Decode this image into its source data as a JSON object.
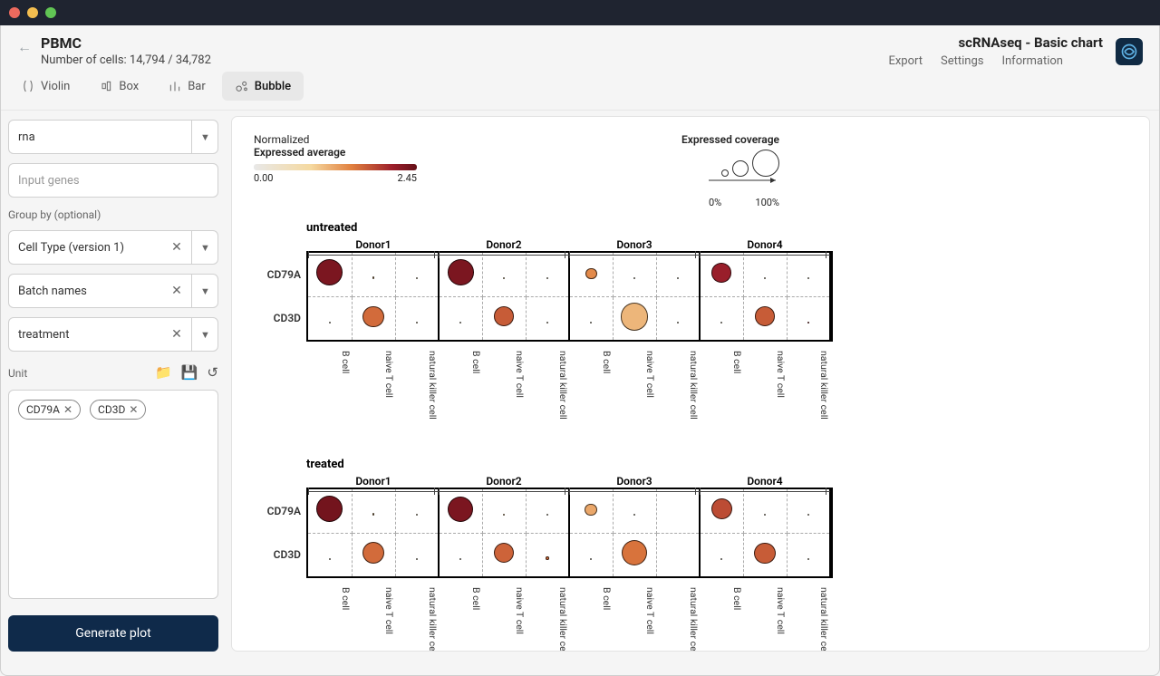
{
  "header": {
    "title": "PBMC",
    "subtitle": "Number of cells: 14,794 / 34,782",
    "brand": "scRNAseq - Basic chart",
    "nav": {
      "export": "Export",
      "settings": "Settings",
      "information": "Information"
    }
  },
  "tabs": {
    "violin": "Violin",
    "box": "Box",
    "bar": "Bar",
    "bubble": "Bubble"
  },
  "sidebar": {
    "assay_value": "rna",
    "gene_placeholder": "Input genes",
    "groupby_label": "Group by (optional)",
    "group1": "Cell Type (version 1)",
    "group2": "Batch names",
    "group3": "treatment",
    "unit_label": "Unit",
    "chips": {
      "c1": "CD79A",
      "c2": "CD3D"
    },
    "generate": "Generate plot"
  },
  "legends": {
    "normalized": "Normalized",
    "expr_avg": "Expressed average",
    "min": "0.00",
    "max": "2.45",
    "coverage": "Expressed coverage",
    "cov_min": "0%",
    "cov_max": "100%"
  },
  "panels": {
    "p1": "untreated",
    "p2": "treated"
  },
  "donors": {
    "d1": "Donor1",
    "d2": "Donor2",
    "d3": "Donor3",
    "d4": "Donor4"
  },
  "genes": {
    "g1": "CD79A",
    "g2": "CD3D"
  },
  "celltypes": {
    "c1": "B cell",
    "c2": "naive T cell",
    "c3": "natural killer cell"
  },
  "chart_data": {
    "type": "bubble",
    "size_encodes": "expressed_coverage_percent",
    "color_encodes": "expressed_average",
    "color_scale": [
      0.0,
      2.45
    ],
    "size_scale_percent": [
      0,
      100
    ],
    "cell_types": [
      "B cell",
      "naive T cell",
      "natural killer cell"
    ],
    "donors": [
      "Donor1",
      "Donor2",
      "Donor3",
      "Donor4"
    ],
    "genes": [
      "CD79A",
      "CD3D"
    ],
    "panels": [
      {
        "treatment": "untreated",
        "values": [
          {
            "gene": "CD79A",
            "donor": "Donor1",
            "cell_type": "B cell",
            "avg": 2.3,
            "cov": 80
          },
          {
            "gene": "CD79A",
            "donor": "Donor1",
            "cell_type": "naive T cell",
            "avg": 1.0,
            "cov": 8
          },
          {
            "gene": "CD79A",
            "donor": "Donor1",
            "cell_type": "natural killer cell",
            "avg": 0.5,
            "cov": 3
          },
          {
            "gene": "CD79A",
            "donor": "Donor2",
            "cell_type": "B cell",
            "avg": 2.3,
            "cov": 80
          },
          {
            "gene": "CD79A",
            "donor": "Donor2",
            "cell_type": "naive T cell",
            "avg": 0.8,
            "cov": 5
          },
          {
            "gene": "CD79A",
            "donor": "Donor2",
            "cell_type": "natural killer cell",
            "avg": 0.4,
            "cov": 2
          },
          {
            "gene": "CD79A",
            "donor": "Donor3",
            "cell_type": "B cell",
            "avg": 1.4,
            "cov": 35
          },
          {
            "gene": "CD79A",
            "donor": "Donor3",
            "cell_type": "naive T cell",
            "avg": 0.3,
            "cov": 2
          },
          {
            "gene": "CD79A",
            "donor": "Donor3",
            "cell_type": "natural killer cell",
            "avg": 0.3,
            "cov": 2
          },
          {
            "gene": "CD79A",
            "donor": "Donor4",
            "cell_type": "B cell",
            "avg": 2.1,
            "cov": 60
          },
          {
            "gene": "CD79A",
            "donor": "Donor4",
            "cell_type": "naive T cell",
            "avg": 0.4,
            "cov": 3
          },
          {
            "gene": "CD79A",
            "donor": "Donor4",
            "cell_type": "natural killer cell",
            "avg": 0.4,
            "cov": 3
          },
          {
            "gene": "CD3D",
            "donor": "Donor1",
            "cell_type": "B cell",
            "avg": 0.3,
            "cov": 2
          },
          {
            "gene": "CD3D",
            "donor": "Donor1",
            "cell_type": "naive T cell",
            "avg": 1.6,
            "cov": 65
          },
          {
            "gene": "CD3D",
            "donor": "Donor1",
            "cell_type": "natural killer cell",
            "avg": 0.5,
            "cov": 4
          },
          {
            "gene": "CD3D",
            "donor": "Donor2",
            "cell_type": "B cell",
            "avg": 0.3,
            "cov": 2
          },
          {
            "gene": "CD3D",
            "donor": "Donor2",
            "cell_type": "naive T cell",
            "avg": 1.7,
            "cov": 60
          },
          {
            "gene": "CD3D",
            "donor": "Donor2",
            "cell_type": "natural killer cell",
            "avg": 0.4,
            "cov": 3
          },
          {
            "gene": "CD3D",
            "donor": "Donor3",
            "cell_type": "B cell",
            "avg": 0.3,
            "cov": 2
          },
          {
            "gene": "CD3D",
            "donor": "Donor3",
            "cell_type": "naive T cell",
            "avg": 1.1,
            "cov": 85
          },
          {
            "gene": "CD3D",
            "donor": "Donor3",
            "cell_type": "natural killer cell",
            "avg": 0.3,
            "cov": 2
          },
          {
            "gene": "CD3D",
            "donor": "Donor4",
            "cell_type": "B cell",
            "avg": 0.3,
            "cov": 2
          },
          {
            "gene": "CD3D",
            "donor": "Donor4",
            "cell_type": "naive T cell",
            "avg": 1.7,
            "cov": 60
          },
          {
            "gene": "CD3D",
            "donor": "Donor4",
            "cell_type": "natural killer cell",
            "avg": 2.0,
            "cov": 6
          },
          {
            "gene": "CD79A",
            "donor": "Donor1",
            "cell_type": "B cell",
            "avg": 2.35,
            "cov": 80,
            "panel": "treated"
          },
          {
            "gene": "CD79A",
            "donor": "Donor1",
            "cell_type": "naive T cell",
            "avg": 1.0,
            "cov": 8,
            "panel": "treated"
          },
          {
            "gene": "CD79A",
            "donor": "Donor1",
            "cell_type": "natural killer cell",
            "avg": 0.5,
            "cov": 3,
            "panel": "treated"
          },
          {
            "gene": "CD79A",
            "donor": "Donor2",
            "cell_type": "B cell",
            "avg": 2.3,
            "cov": 78,
            "panel": "treated"
          },
          {
            "gene": "CD79A",
            "donor": "Donor2",
            "cell_type": "naive T cell",
            "avg": 1.0,
            "cov": 6,
            "panel": "treated"
          },
          {
            "gene": "CD79A",
            "donor": "Donor2",
            "cell_type": "natural killer cell",
            "avg": 0.4,
            "cov": 3,
            "panel": "treated"
          },
          {
            "gene": "CD79A",
            "donor": "Donor3",
            "cell_type": "B cell",
            "avg": 1.2,
            "cov": 38,
            "panel": "treated"
          },
          {
            "gene": "CD79A",
            "donor": "Donor3",
            "cell_type": "naive T cell",
            "avg": 0.3,
            "cov": 2,
            "panel": "treated"
          },
          {
            "gene": "CD79A",
            "donor": "Donor3",
            "cell_type": "natural killer cell",
            "avg": 0.0,
            "cov": 0,
            "panel": "treated"
          },
          {
            "gene": "CD79A",
            "donor": "Donor4",
            "cell_type": "B cell",
            "avg": 1.8,
            "cov": 65,
            "panel": "treated"
          },
          {
            "gene": "CD79A",
            "donor": "Donor4",
            "cell_type": "naive T cell",
            "avg": 0.4,
            "cov": 3,
            "panel": "treated"
          },
          {
            "gene": "CD79A",
            "donor": "Donor4",
            "cell_type": "natural killer cell",
            "avg": 0.4,
            "cov": 3,
            "panel": "treated"
          },
          {
            "gene": "CD3D",
            "donor": "Donor1",
            "cell_type": "B cell",
            "avg": 0.3,
            "cov": 2,
            "panel": "treated"
          },
          {
            "gene": "CD3D",
            "donor": "Donor1",
            "cell_type": "naive T cell",
            "avg": 1.6,
            "cov": 68,
            "panel": "treated"
          },
          {
            "gene": "CD3D",
            "donor": "Donor1",
            "cell_type": "natural killer cell",
            "avg": 0.4,
            "cov": 3,
            "panel": "treated"
          },
          {
            "gene": "CD3D",
            "donor": "Donor2",
            "cell_type": "B cell",
            "avg": 0.3,
            "cov": 2,
            "panel": "treated"
          },
          {
            "gene": "CD3D",
            "donor": "Donor2",
            "cell_type": "naive T cell",
            "avg": 1.65,
            "cov": 62,
            "panel": "treated"
          },
          {
            "gene": "CD3D",
            "donor": "Donor2",
            "cell_type": "natural killer cell",
            "avg": 1.6,
            "cov": 10,
            "panel": "treated"
          },
          {
            "gene": "CD3D",
            "donor": "Donor3",
            "cell_type": "B cell",
            "avg": 0.3,
            "cov": 2,
            "panel": "treated"
          },
          {
            "gene": "CD3D",
            "donor": "Donor3",
            "cell_type": "naive T cell",
            "avg": 1.55,
            "cov": 78,
            "panel": "treated"
          },
          {
            "gene": "CD3D",
            "donor": "Donor3",
            "cell_type": "natural killer cell",
            "avg": 0.0,
            "cov": 0,
            "panel": "treated"
          },
          {
            "gene": "CD3D",
            "donor": "Donor4",
            "cell_type": "B cell",
            "avg": 0.3,
            "cov": 2,
            "panel": "treated"
          },
          {
            "gene": "CD3D",
            "donor": "Donor4",
            "cell_type": "naive T cell",
            "avg": 1.7,
            "cov": 65,
            "panel": "treated"
          },
          {
            "gene": "CD3D",
            "donor": "Donor4",
            "cell_type": "natural killer cell",
            "avg": 0.4,
            "cov": 3,
            "panel": "treated"
          }
        ]
      }
    ]
  }
}
